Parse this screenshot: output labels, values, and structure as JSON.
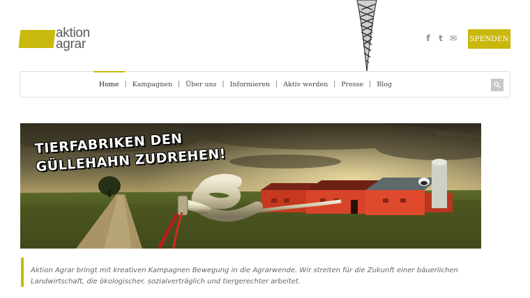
{
  "header": {
    "logo_line1": "aktion",
    "logo_line2": "agrar",
    "social": [
      {
        "icon": "facebook-icon",
        "glyph": "f"
      },
      {
        "icon": "twitter-icon",
        "glyph": "t"
      },
      {
        "icon": "mail-icon",
        "glyph": "✉"
      }
    ],
    "donate_label": "SPENDEN"
  },
  "nav": {
    "items": [
      "Home",
      "Kampagnen",
      "Über uns",
      "Informieren",
      "Aktiv werden",
      "Presse",
      "Blog"
    ],
    "separator": "|",
    "active": "Home"
  },
  "banner": {
    "headline": "TIERFABRIKEN DEN GÜLLEHAHN ZUDREHEN!"
  },
  "intro": {
    "text": "Aktion Agrar bringt mit kreativen Kampagnen Bewegung in die Agrarwende. Wir streiten für die Zukunft einer bäuerlichen Landwirtschaft, die ökologischer, sozialverträglich und tiergerechter arbeitet."
  },
  "colors": {
    "accent": "#c9b80e",
    "text_muted": "#666666",
    "nav_border": "#dddddd"
  }
}
